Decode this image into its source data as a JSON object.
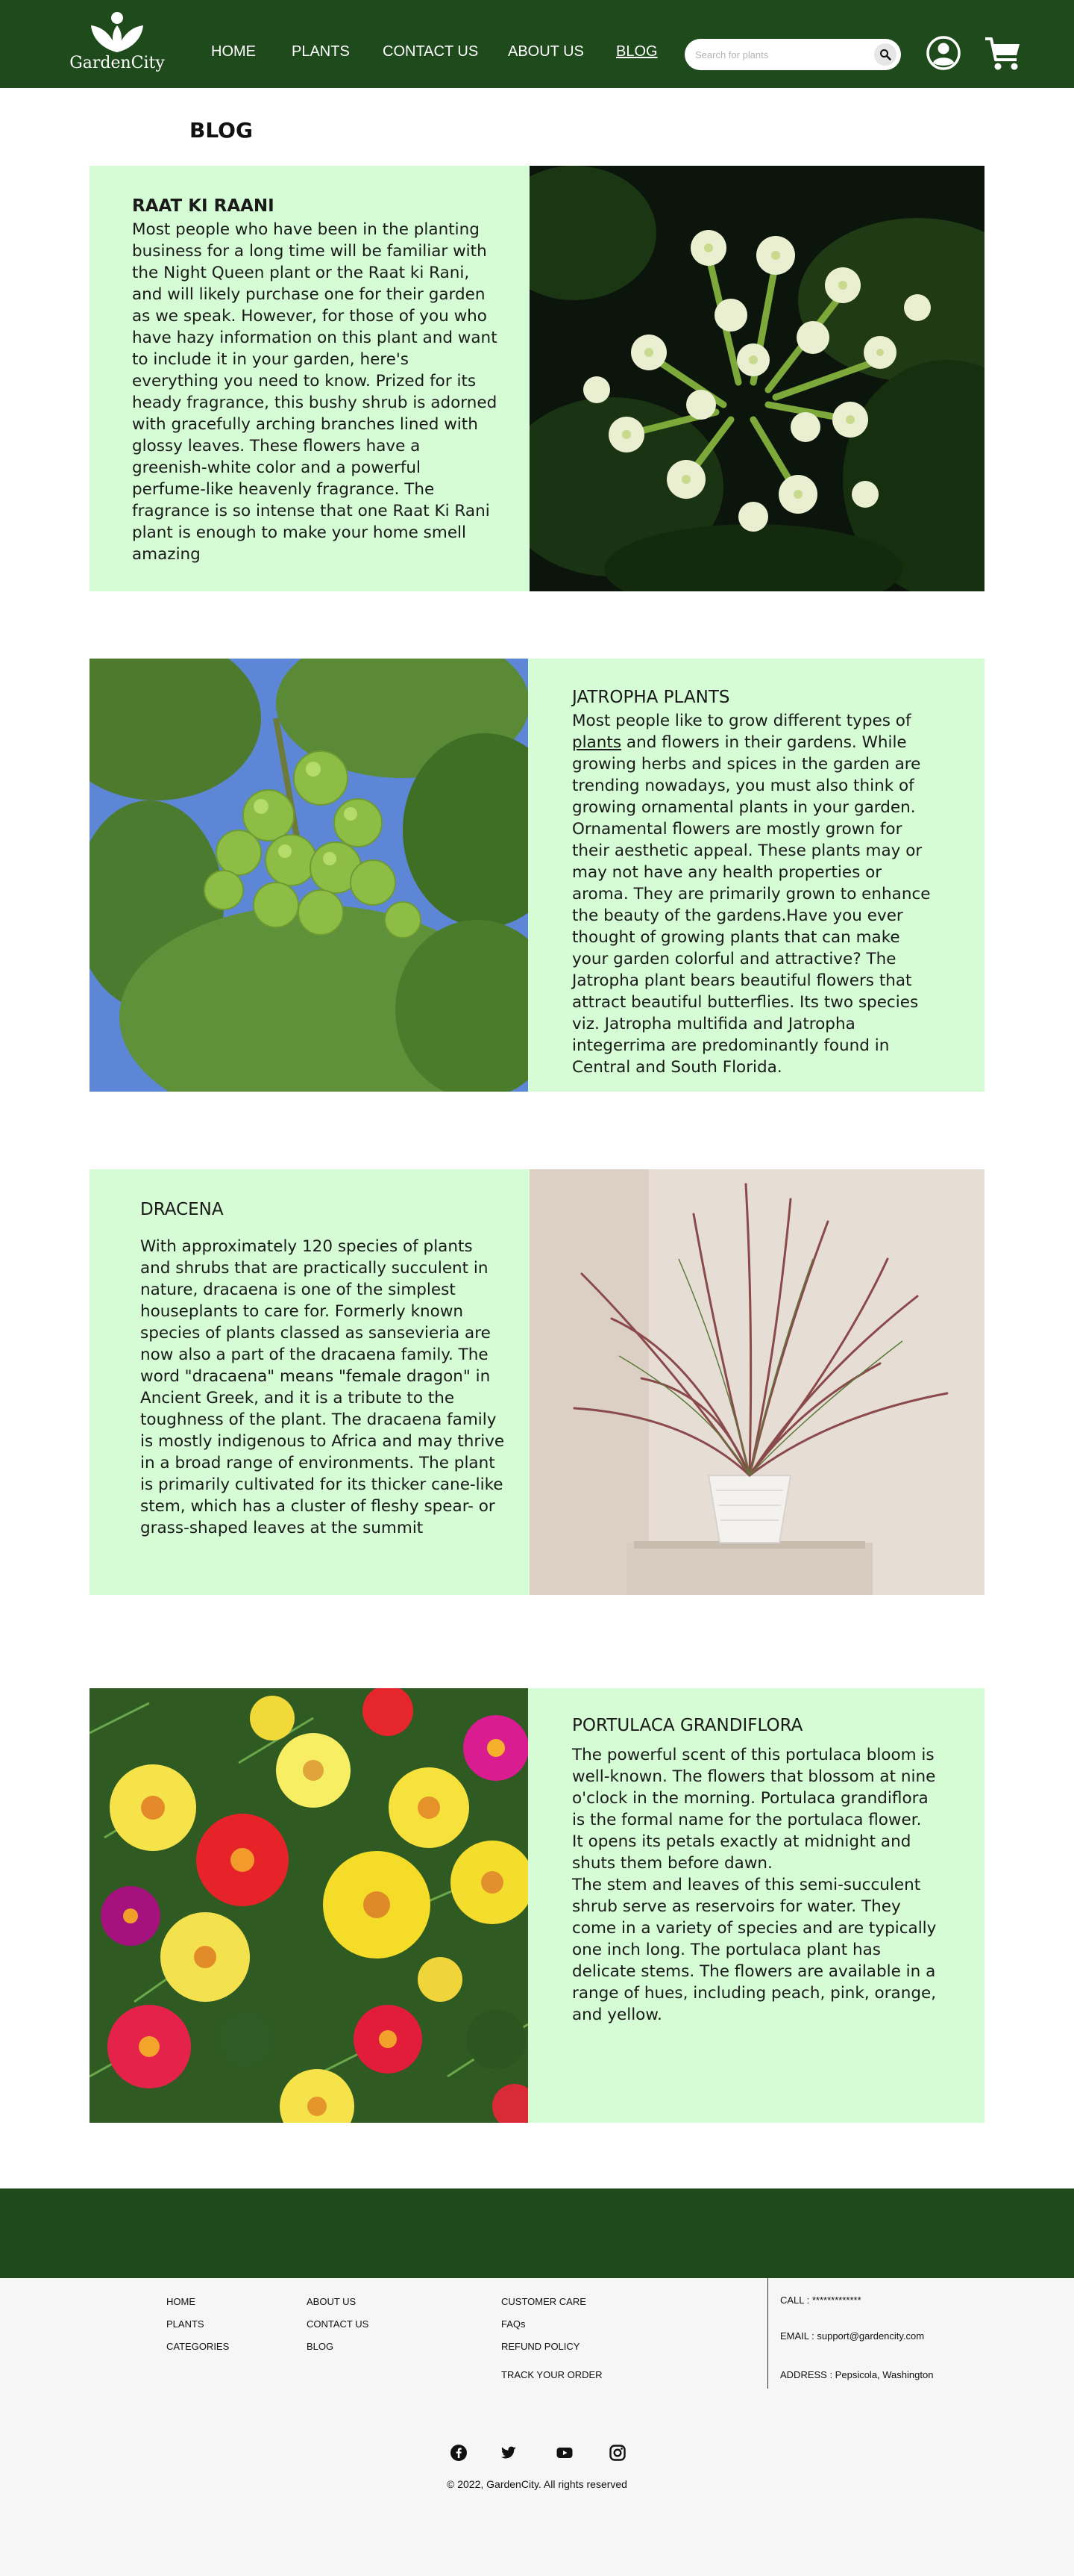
{
  "header": {
    "brand": "GardenCity",
    "nav": [
      "HOME",
      "PLANTS",
      "CONTACT US",
      "ABOUT US",
      "BLOG"
    ],
    "search_placeholder": "Search for plants",
    "colors": {
      "bar": "#1e4a1c",
      "text": "#ffffff"
    }
  },
  "page_title": "BLOG",
  "posts": [
    {
      "title": "RAAT KI RAANI",
      "body": "Most people who have been in the planting business for a long time will be familiar with the Night Queen plant or the Raat ki Rani, and will likely purchase one for their garden as we speak. However, for those of you who have hazy information on this plant and want to include it in your garden, here's everything you need to know. Prized for its heady fragrance, this bushy shrub is adorned with gracefully arching branches lined with glossy leaves. These flowers have a greenish-white color and a powerful perfume-like heavenly fragrance. The fragrance is so intense that one Raat Ki Rani plant is enough to make your home smell amazing"
    },
    {
      "title": "JATROPHA PLANTS",
      "body_before_link": "Most people like to grow different types of ",
      "link": "plants",
      "body_after_link": " and flowers in their gardens. While growing herbs and spices in the garden are trending nowadays, you must also think of growing ornamental plants in your garden. Ornamental flowers are mostly grown for their aesthetic appeal. These plants may or may not have any health properties or aroma. They are primarily grown to enhance the beauty of the gardens.Have you ever thought of growing plants that can make your garden colorful and attractive? The Jatropha plant bears beautiful flowers that attract beautiful butterflies. Its two species viz. Jatropha multifida and Jatropha integerrima are predominantly found in Central and South Florida."
    },
    {
      "title": "DRACENA",
      "body": "With approximately 120 species of plants and shrubs that are practically succulent in nature, dracaena is one of the simplest houseplants to care for. Formerly known species of plants classed as sansevieria are now also a part of the dracaena family. The word \"dracaena\" means \"female dragon\" in Ancient Greek, and it is a tribute to the toughness of the plant. The dracaena family is mostly indigenous to Africa and may thrive in a broad range of environments. The plant is primarily cultivated for its thicker cane-like stem, which has a cluster of fleshy spear- or grass-shaped leaves at the summit"
    },
    {
      "title": "PORTULACA GRANDIFLORA",
      "body1": "The powerful scent of this portulaca bloom is well-known. The flowers that blossom at nine o'clock in the morning. Portulaca grandiflora is the formal name for the portulaca flower. It opens its petals exactly at midnight and shuts them before dawn.",
      "body2": "The stem and leaves of this semi-succulent shrub serve as reservoirs for water. They come in a variety of species and are typically one inch long. The portulaca plant has delicate stems. The flowers are available in a range of hues, including peach, pink, orange, and yellow."
    }
  ],
  "post_background": "#d5fcd4",
  "footer": {
    "col1": [
      "HOME",
      "PLANTS",
      "CATEGORIES"
    ],
    "col2": [
      "ABOUT US",
      "CONTACT US",
      "BLOG"
    ],
    "col3": [
      "CUSTOMER CARE",
      "FAQs",
      "REFUND POLICY",
      "TRACK YOUR ORDER"
    ],
    "call": "CALL : *************",
    "email": "EMAIL : support@gardencity.com",
    "address": "ADDRESS : Pepsicola, Washington",
    "social": [
      "facebook-icon",
      "twitter-icon",
      "youtube-icon",
      "instagram-icon"
    ],
    "copyright": "© 2022, GardenCity. All rights reserved"
  }
}
